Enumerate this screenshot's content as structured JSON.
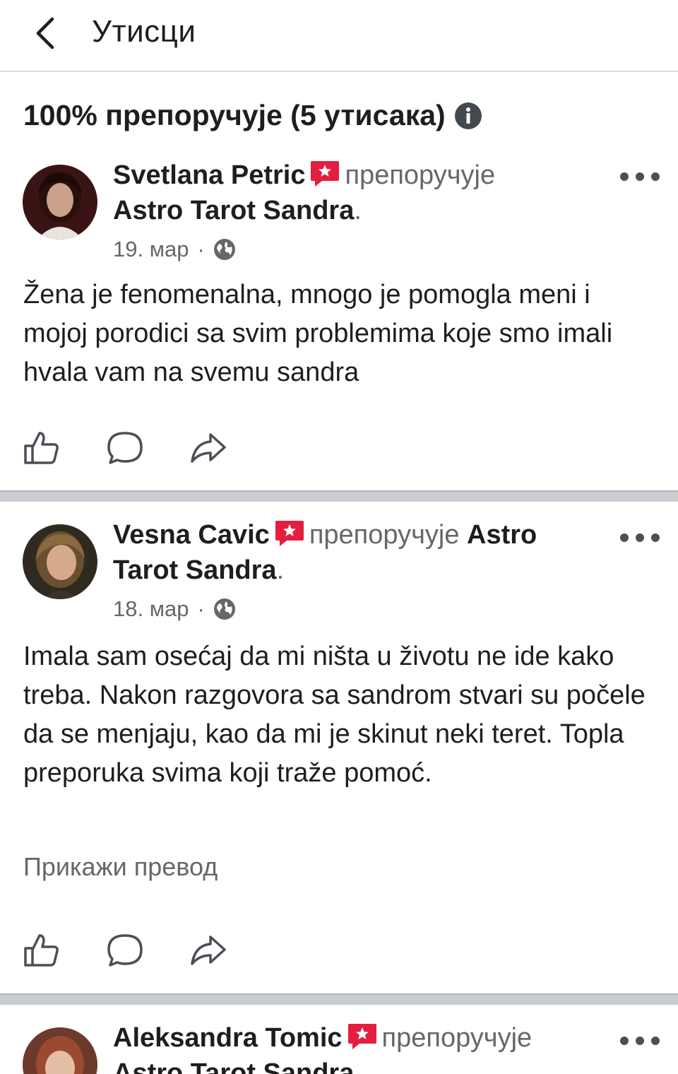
{
  "header": {
    "title": "Утисци",
    "back_icon": "chevron-left-icon"
  },
  "summary": {
    "text": "100% препоручује (5 утисака)",
    "info_icon": "info-icon"
  },
  "colors": {
    "text": "#1c1e21",
    "secondary": "#65676b",
    "badge": "#e41e3f",
    "separator": "#c9ccd1"
  },
  "reviews": [
    {
      "author": "Svetlana Petric",
      "recommends": "препоручује",
      "page": "Astro Tarot Sandra",
      "date": "19. мар",
      "separator_dot": "·",
      "text": "Žena je fenomenalna, mnogo je pomogla meni i mojoj porodici sa svim problemima koje smo imali hvala vam na svemu sandra",
      "actions": [
        "like-icon",
        "comment-icon",
        "share-icon"
      ]
    },
    {
      "author": "Vesna Cavic",
      "recommends": "препоручује",
      "page": "Astro Tarot Sandra",
      "date": "18. мар",
      "separator_dot": "·",
      "text": "Imala sam osećaj da mi ništa u životu ne ide kako treba. Nakon razgovora sa sandrom stvari su počele da se menjaju, kao da mi je skinut neki teret. Topla preporuka svima koji traže pomoć.",
      "translate_link": "Прикажи превод",
      "actions": [
        "like-icon",
        "comment-icon",
        "share-icon"
      ]
    },
    {
      "author": "Aleksandra Tomic",
      "recommends": "препоручује",
      "page": "Astro Tarot Sandra"
    }
  ]
}
